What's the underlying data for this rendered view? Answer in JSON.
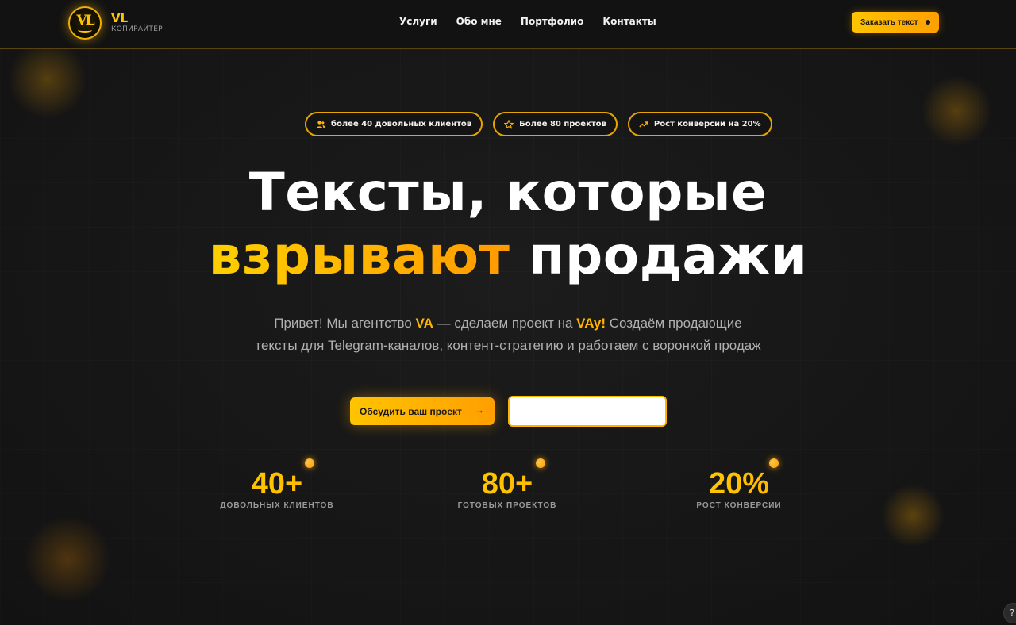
{
  "header": {
    "logo_mark": "VL",
    "logo_title": "VL",
    "logo_subtitle": "КОПИРАЙТЕР",
    "nav": [
      "Услуги",
      "Обо мне",
      "Портфолио",
      "Контакты"
    ],
    "cta_label": "Заказать текст"
  },
  "badges": [
    {
      "icon": "users-icon",
      "label": "более 40 довольных клиентов"
    },
    {
      "icon": "star-icon",
      "label": "Более 80 проектов"
    },
    {
      "icon": "trend-up-icon",
      "label": "Рост конверсии на 20%"
    }
  ],
  "hero": {
    "headline_line1": "Тексты, которые",
    "headline_accent": "взрывают",
    "headline_line2_rest": " продажи",
    "subtitle_part1": "Привет! Мы агентство ",
    "subtitle_hl1": "VA",
    "subtitle_part2": " — сделаем проект на ",
    "subtitle_hl2": "VAy!",
    "subtitle_part3": " Создаём продающие тексты для Telegram-каналов, контент-стратегию и работаем с воронкой продаж",
    "primary_button": "Обсудить ваш проект",
    "primary_button_arrow": "→"
  },
  "stats": [
    {
      "value": "40+",
      "label": "ДОВОЛЬНЫХ КЛИЕНТОВ"
    },
    {
      "value": "80+",
      "label": "ГОТОВЫХ ПРОЕКТОВ"
    },
    {
      "value": "20%",
      "label": "РОСТ КОНВЕРСИИ"
    }
  ],
  "help_label": "?",
  "colors": {
    "accent": "#ffc400",
    "accent_end": "#ff9f00",
    "background": "#1c1c1c"
  }
}
